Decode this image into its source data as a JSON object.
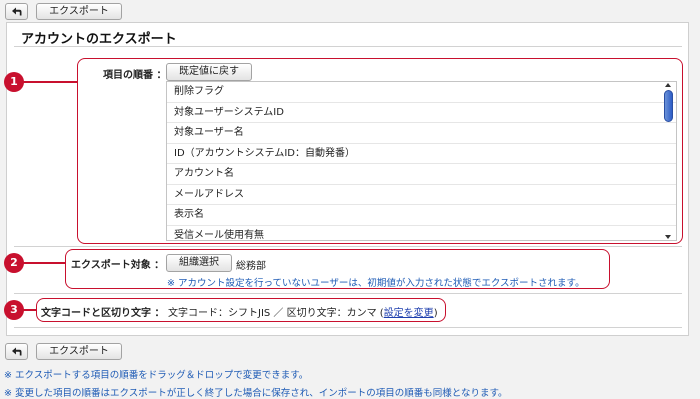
{
  "toolbar": {
    "back_icon": "back-arrow-icon",
    "export_label": "エクスポート"
  },
  "page": {
    "title": "アカウントのエクスポート"
  },
  "callouts": {
    "c1": "1",
    "c2": "2",
    "c3": "3"
  },
  "order": {
    "label": "項目の順番 ：",
    "reset_button": "既定値に戻す",
    "items": [
      "削除フラグ",
      "対象ユーザーシステムID",
      "対象ユーザー名",
      "ID（アカウントシステムID：自動発番）",
      "アカウント名",
      "メールアドレス",
      "表示名",
      "受信メール使用有無"
    ]
  },
  "target": {
    "label": "エクスポート対象 ：",
    "select_button": "組織選択",
    "value": "総務部",
    "note": "※ アカウント設定を行っていないユーザーは、初期値が入力された状態でエクスポートされます。"
  },
  "encoding": {
    "label": "文字コードと区切り文字 ：",
    "value": "文字コード：シフトJIS ／ 区切り文字：カンマ (",
    "link": "設定を変更",
    "close": ")"
  },
  "footnotes": {
    "line1": "※ エクスポートする項目の順番をドラッグ＆ドロップで変更できます。",
    "line2": "※ 変更した項目の順番はエクスポートが正しく終了した場合に保存され、インポートの項目の順番も同様となります。"
  },
  "colors": {
    "accent": "#c8102e",
    "note_text": "#1e5bb5",
    "scroll_thumb": "#2d5dc6"
  }
}
